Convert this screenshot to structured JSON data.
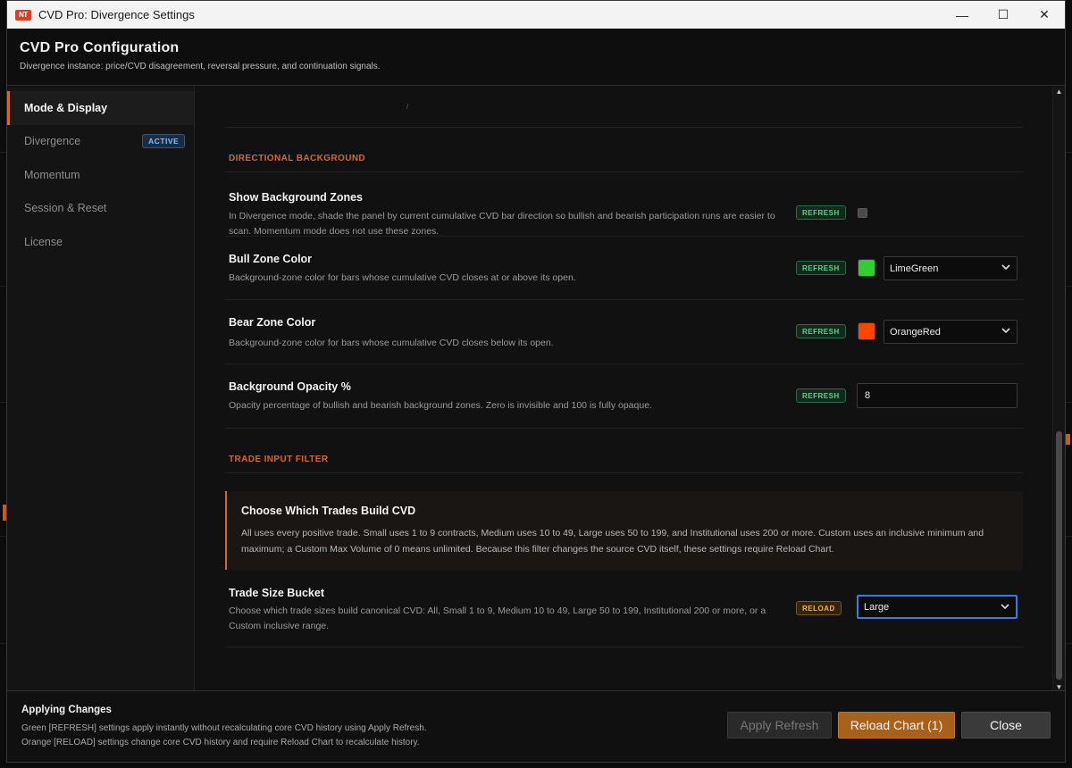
{
  "window": {
    "logo": "NT",
    "title": "CVD Pro: Divergence Settings",
    "controls": {
      "minimize": "—",
      "maximize": "☐",
      "close": "✕"
    }
  },
  "header": {
    "title": "CVD Pro Configuration",
    "subtitle": "Divergence instance: price/CVD disagreement, reversal pressure, and continuation signals."
  },
  "sidebar": {
    "items": [
      {
        "label": "Mode & Display"
      },
      {
        "label": "Divergence",
        "badge": "ACTIVE"
      },
      {
        "label": "Momentum"
      },
      {
        "label": "Session & Reset"
      },
      {
        "label": "License"
      }
    ]
  },
  "content": {
    "top_tick": "/",
    "sections": [
      {
        "heading": "DIRECTIONAL BACKGROUND",
        "rows": [
          {
            "label": "Show Background Zones",
            "desc": "In Divergence mode, shade the panel by current cumulative CVD bar direction so bullish and bearish participation runs are easier to scan. Momentum mode does not use these zones.",
            "pill": "REFRESH",
            "checked": false
          },
          {
            "label": "Bull Zone Color",
            "desc": "Background-zone color for bars whose cumulative CVD closes at or above its open.",
            "pill": "REFRESH",
            "color": "#32cd32",
            "value": "LimeGreen"
          },
          {
            "label": "Bear Zone Color",
            "desc": "Background-zone color for bars whose cumulative CVD closes below its open.",
            "pill": "REFRESH",
            "color": "#ff4500",
            "value": "OrangeRed"
          },
          {
            "label": "Background Opacity %",
            "desc": "Opacity percentage of bullish and bearish background zones. Zero is invisible and 100 is fully opaque.",
            "pill": "REFRESH",
            "value": "8"
          }
        ]
      },
      {
        "heading": "TRADE INPUT FILTER",
        "callout": {
          "title": "Choose Which Trades Build CVD",
          "text": "All uses every positive trade. Small uses 1 to 9 contracts, Medium uses 10 to 49, Large uses 50 to 199, and Institutional uses 200 or more. Custom uses an inclusive minimum and maximum; a Custom Max Volume of 0 means unlimited. Because this filter changes the source CVD itself, these settings require Reload Chart."
        },
        "rows": [
          {
            "label": "Trade Size Bucket",
            "desc": "Choose which trade sizes build canonical CVD: All, Small 1 to 9, Medium 10 to 49, Large 50 to 199, Institutional 200 or more, or a Custom inclusive range.",
            "pill": "RELOAD",
            "value": "Large"
          }
        ]
      }
    ]
  },
  "footer": {
    "title": "Applying Changes",
    "line1": "Green [REFRESH] settings apply instantly without recalculating core CVD history using Apply Refresh.",
    "line2": "Orange [RELOAD] settings change core CVD history and require Reload Chart to recalculate history.",
    "apply_label": "Apply Refresh",
    "reload_label": "Reload Chart (1)",
    "close_label": "Close"
  },
  "colors": {
    "accent": "#d1692b",
    "refresh": "#5ed18e",
    "reload": "#f0b14a",
    "focus": "#3b7ae0"
  }
}
